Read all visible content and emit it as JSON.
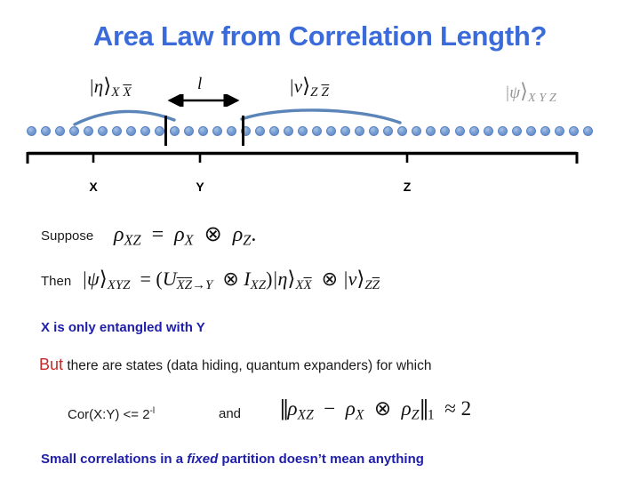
{
  "slide": {
    "title": "Area Law from Correlation Length?"
  },
  "diagram": {
    "labels": {
      "eta": {
        "ket": "|η⟩",
        "sub_plain": "X",
        "sub_overline": "X"
      },
      "nu": {
        "ket": "|ν⟩",
        "sub_plain": "Z",
        "sub_overline": "Z"
      },
      "psi": {
        "ket": "|ψ⟩",
        "sub": "XYZ"
      }
    },
    "length_arrow_label": "l",
    "regions": [
      {
        "name": "X",
        "label": "X"
      },
      {
        "name": "Y",
        "label": "Y"
      },
      {
        "name": "Z",
        "label": "Z"
      }
    ],
    "chain": {
      "site_count": 40,
      "dot_color": "#6d97cd"
    }
  },
  "body": {
    "suppose_word": "Suppose",
    "suppose_equation": "ρXZ = ρX ⊗ ρZ.",
    "then_word": "Then",
    "then_equation": "|ψ⟩XYZ = (UX̅Z̅→Y ⊗ IXZ)|η⟩XX̅ ⊗ |ν⟩ZZ̅",
    "entangled_line": "X is only entangled with Y",
    "but_word": "But",
    "but_rest": " there are states (data hiding, quantum expanders) for which",
    "cor_text": "Cor(X:Y) <= 2",
    "cor_exponent": "-l",
    "and_word": "and",
    "cor_equation": "‖ρXZ − ρX ⊗ ρZ‖1 ≈ 2",
    "approx_value": "2",
    "conclusion_pre": "Small correlations in a ",
    "conclusion_em": "fixed",
    "conclusion_post": " partition doesn’t mean anything"
  },
  "colors": {
    "title_blue": "#3b6bdb",
    "heading_blue": "#1e1eaa",
    "but_red": "#c32b2b",
    "dot_blue": "#6d97cd",
    "arc_blue": "#5b85b8"
  }
}
